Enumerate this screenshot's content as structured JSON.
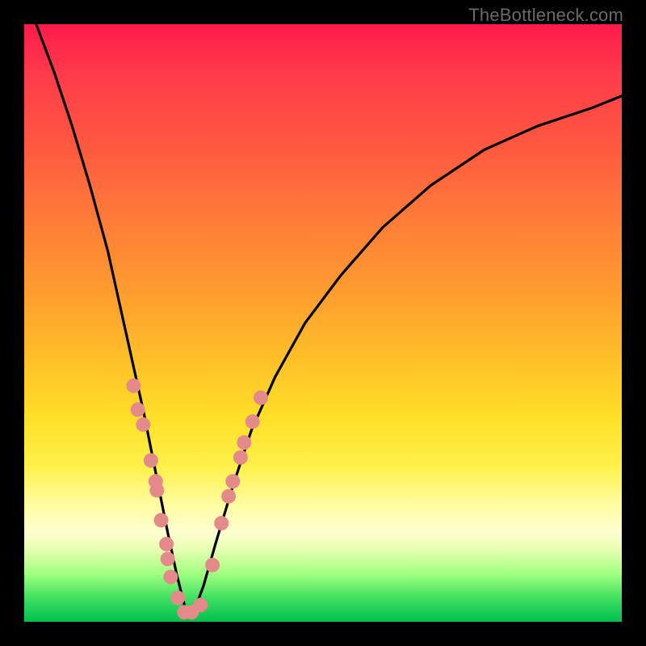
{
  "attribution": "TheBottleneck.com",
  "colors": {
    "gradient_top": "#ff1a4b",
    "gradient_mid": "#ffe028",
    "gradient_bottom": "#00c050",
    "curve": "#000000",
    "point_fill": "#e58a8a",
    "point_stroke": "#b55a5a",
    "frame": "#000000"
  },
  "chart_data": {
    "type": "line",
    "title": "",
    "xlabel": "",
    "ylabel": "",
    "xlim": [
      0,
      100
    ],
    "ylim": [
      0,
      100
    ],
    "grid": false,
    "legend": false,
    "notes": "V-shaped bottleneck curve. y≈100 at left edge, drops steeply to ≈0 around x≈27, rises back toward y≈88 at right edge with diminishing slope. No numeric axes or ticks are rendered; values below are read off pixel positions normalised to 0–100.",
    "series": [
      {
        "name": "bottleneck-curve",
        "x": [
          2,
          5,
          8,
          11,
          14,
          16,
          18,
          20,
          22,
          24,
          25.5,
          27,
          28.5,
          30,
          32,
          35,
          38,
          42,
          47,
          53,
          60,
          68,
          77,
          86,
          95,
          100
        ],
        "y": [
          100,
          92,
          83,
          73,
          62,
          53,
          44,
          35,
          25,
          15,
          8,
          2,
          2,
          6,
          13,
          23,
          32,
          41,
          50,
          58,
          66,
          73,
          79,
          83,
          86,
          88
        ]
      }
    ],
    "points": [
      {
        "x": 18.3,
        "y": 39.5
      },
      {
        "x": 19.0,
        "y": 35.5
      },
      {
        "x": 19.9,
        "y": 33.0
      },
      {
        "x": 21.2,
        "y": 27.0
      },
      {
        "x": 22.0,
        "y": 23.5
      },
      {
        "x": 22.2,
        "y": 22.0
      },
      {
        "x": 22.9,
        "y": 17.0
      },
      {
        "x": 23.8,
        "y": 13.0
      },
      {
        "x": 24.0,
        "y": 10.5
      },
      {
        "x": 24.5,
        "y": 7.5
      },
      {
        "x": 25.7,
        "y": 4.0
      },
      {
        "x": 26.8,
        "y": 1.6
      },
      {
        "x": 28.0,
        "y": 1.6
      },
      {
        "x": 29.5,
        "y": 2.8
      },
      {
        "x": 31.5,
        "y": 9.5
      },
      {
        "x": 33.0,
        "y": 16.5
      },
      {
        "x": 34.2,
        "y": 21.0
      },
      {
        "x": 34.9,
        "y": 23.5
      },
      {
        "x": 36.2,
        "y": 27.5
      },
      {
        "x": 36.8,
        "y": 30.0
      },
      {
        "x": 38.2,
        "y": 33.5
      },
      {
        "x": 39.6,
        "y": 37.5
      }
    ]
  }
}
